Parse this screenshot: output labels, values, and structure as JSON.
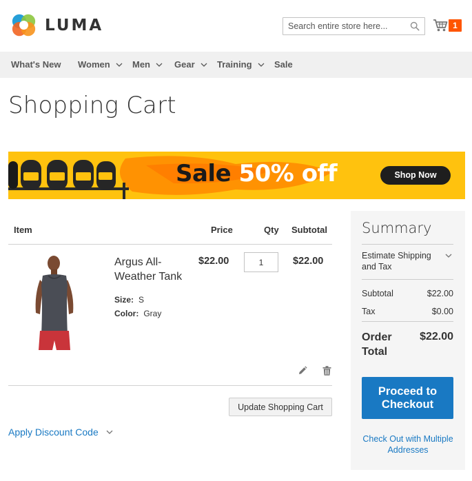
{
  "header": {
    "logo_text": "LUMA",
    "search_placeholder": "Search entire store here...",
    "cart_count": "1"
  },
  "nav": {
    "items": [
      {
        "label": "What's New",
        "has_dropdown": false
      },
      {
        "label": "Women",
        "has_dropdown": true
      },
      {
        "label": "Men",
        "has_dropdown": true
      },
      {
        "label": "Gear",
        "has_dropdown": true
      },
      {
        "label": "Training",
        "has_dropdown": true
      },
      {
        "label": "Sale",
        "has_dropdown": false
      }
    ]
  },
  "page": {
    "title": "Shopping Cart"
  },
  "banner": {
    "text_part1": "Sale ",
    "text_part2": "50% off",
    "button_label": "Shop Now"
  },
  "cart": {
    "headers": {
      "item": "Item",
      "price": "Price",
      "qty": "Qty",
      "subtotal": "Subtotal"
    },
    "items": [
      {
        "name": "Argus All-Weather Tank",
        "price": "$22.00",
        "qty": "1",
        "subtotal": "$22.00",
        "options": [
          {
            "label": "Size:",
            "value": "S"
          },
          {
            "label": "Color:",
            "value": "Gray"
          }
        ]
      }
    ],
    "update_button": "Update Shopping Cart",
    "discount_link": "Apply Discount Code"
  },
  "summary": {
    "title": "Summary",
    "estimate_label": "Estimate Shipping and Tax",
    "subtotal_label": "Subtotal",
    "subtotal_value": "$22.00",
    "tax_label": "Tax",
    "tax_value": "$0.00",
    "order_total_label": "Order Total",
    "order_total_value": "$22.00",
    "checkout_button": "Proceed to Checkout",
    "multi_address_link": "Check Out with Multiple Addresses"
  },
  "colors": {
    "accent": "#1979c3",
    "cart_badge": "#ff5501",
    "nav_bg": "#f0f0f0",
    "summary_bg": "#f5f5f5",
    "banner_bg": "#ffbf00"
  },
  "icons": [
    "luma-logo-icon",
    "search-icon",
    "cart-icon",
    "chevron-down-icon",
    "edit-icon",
    "trash-icon"
  ]
}
